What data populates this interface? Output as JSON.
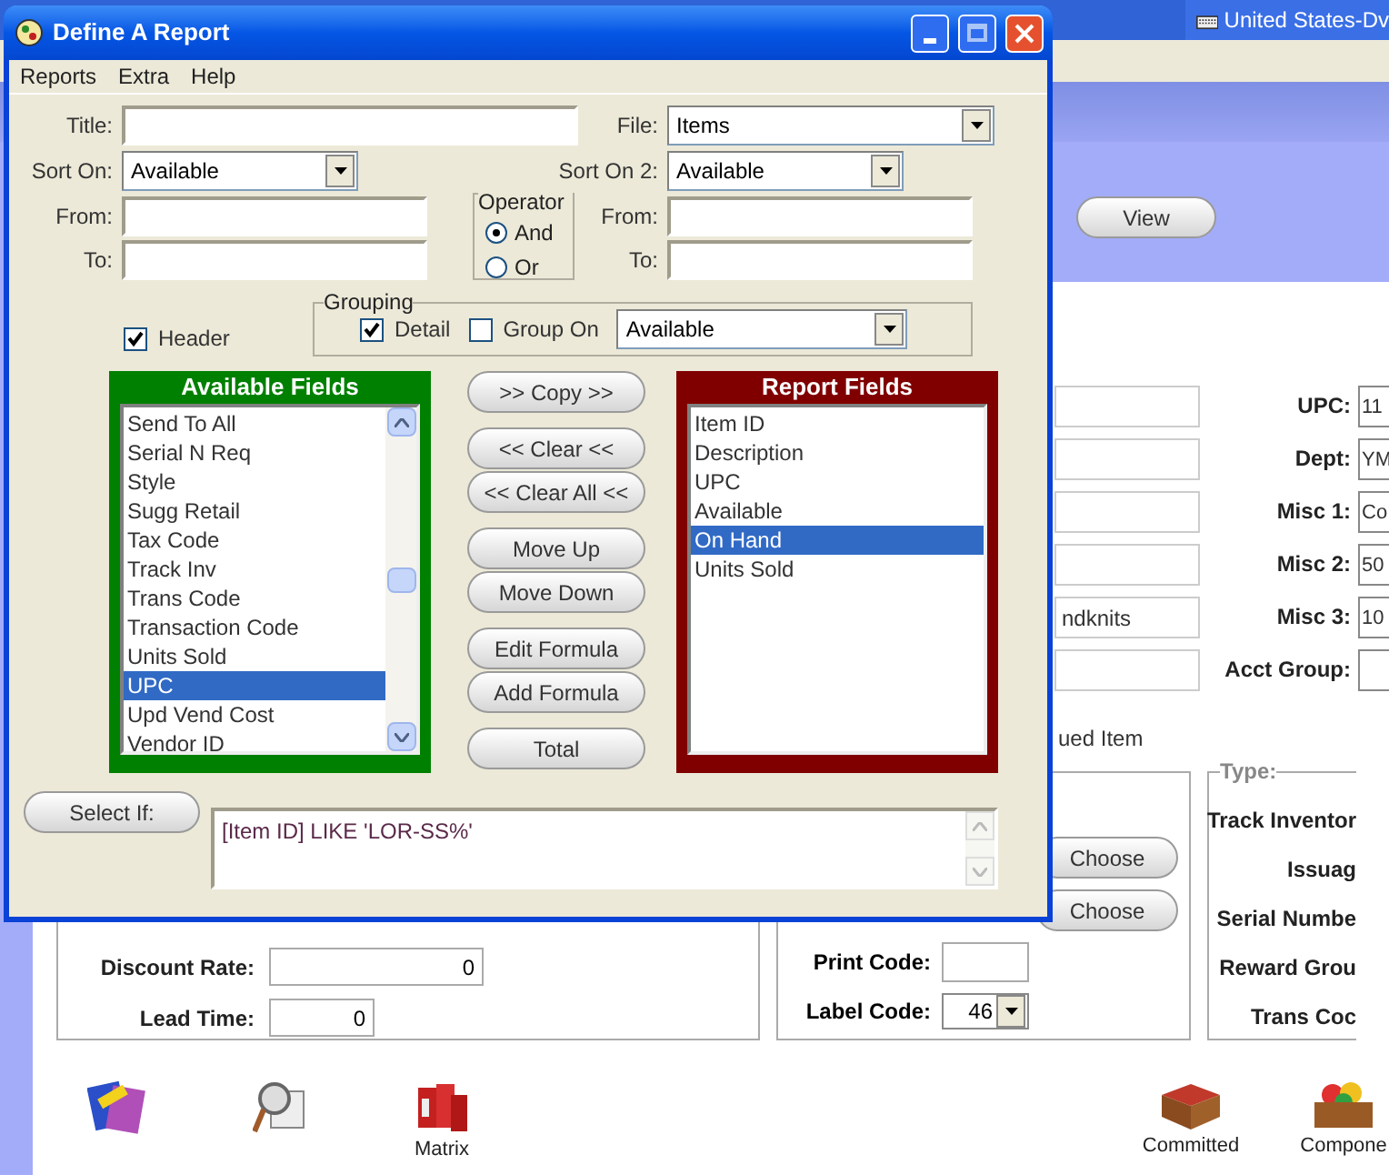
{
  "background": {
    "language_bar": "United States-Dv",
    "view_button": "View",
    "fields": [
      {
        "label": "UPC:",
        "right_value": "11"
      },
      {
        "label": "Dept:",
        "right_value": "YM"
      },
      {
        "label": "Misc 1:",
        "right_value": "Co"
      },
      {
        "label": "Misc 2:",
        "right_value": "50"
      },
      {
        "value": "ndknits",
        "label": "Misc 3:",
        "right_value": "10"
      },
      {
        "label": "Acct Group:"
      }
    ],
    "note": "ued Item",
    "cost_panel": [
      {
        "label": "Discount Rate:",
        "value": "0",
        "kind": "wide"
      },
      {
        "label": "Lead Time:",
        "value": "0",
        "kind": "narrow"
      }
    ],
    "code_panel": {
      "choose_buttons": [
        "Choose",
        "Choose"
      ],
      "print_code": "Print Code:",
      "label_code": "Label Code:",
      "label_code_value": "46"
    },
    "type_panel": {
      "legend": "Type:",
      "labels": [
        "Track Inventor",
        "Issuag",
        "Serial Numbe",
        "Reward Grou",
        "Trans Coc"
      ]
    },
    "toolbar": [
      {
        "kind": "catalog"
      },
      {
        "kind": "po"
      },
      {
        "kind": "matrix",
        "label": "Matrix"
      },
      {
        "kind": "hold",
        "label": "Committed"
      },
      {
        "kind": "parts",
        "label": "Compone"
      }
    ]
  },
  "dialog": {
    "title": "Define A Report",
    "menu": [
      "Reports",
      "Extra",
      "Help"
    ],
    "title_field": {
      "label": "Title:"
    },
    "file": {
      "label": "File:",
      "value": "Items"
    },
    "sort_on": {
      "label": "Sort On:",
      "value": "Available"
    },
    "sort_on_2": {
      "label": "Sort On 2:",
      "value": "Available"
    },
    "from": {
      "label": "From:"
    },
    "to": {
      "label": "To:"
    },
    "operator": {
      "legend": "Operator",
      "options": [
        {
          "label": "And",
          "selected": true
        },
        {
          "label": "Or",
          "selected": false
        }
      ]
    },
    "from_2": {
      "label": "From:"
    },
    "to_2": {
      "label": "To:"
    },
    "header": {
      "label": "Header",
      "checked": true
    },
    "grouping": {
      "legend": "Grouping",
      "detail": {
        "label": "Detail",
        "checked": true
      },
      "group_on": {
        "label": "Group On",
        "checked": false
      },
      "group_field": "Available"
    },
    "available_fields": {
      "title": "Available Fields",
      "items": [
        {
          "label": "Send To All",
          "selected": false
        },
        {
          "label": "Serial N Req",
          "selected": false
        },
        {
          "label": "Style",
          "selected": false
        },
        {
          "label": "Sugg Retail",
          "selected": false
        },
        {
          "label": "Tax Code",
          "selected": false
        },
        {
          "label": "Track Inv",
          "selected": false
        },
        {
          "label": "Trans Code",
          "selected": false
        },
        {
          "label": "Transaction Code",
          "selected": false
        },
        {
          "label": "Units Sold",
          "selected": false
        },
        {
          "label": "UPC",
          "selected": true
        },
        {
          "label": "Upd Vend Cost",
          "selected": false
        },
        {
          "label": "Vendor ID",
          "selected": false
        }
      ]
    },
    "buttons": [
      [
        ">> Copy >>"
      ],
      [
        "<< Clear <<",
        "<< Clear All <<"
      ],
      [
        "Move Up",
        "Move Down"
      ],
      [
        "Edit Formula",
        "Add Formula"
      ],
      [
        "Total"
      ]
    ],
    "report_fields": {
      "title": "Report Fields",
      "items": [
        {
          "label": "Item ID",
          "selected": false
        },
        {
          "label": "Description",
          "selected": false
        },
        {
          "label": "UPC",
          "selected": false
        },
        {
          "label": "Available",
          "selected": false
        },
        {
          "label": "On Hand",
          "selected": true
        },
        {
          "label": "Units Sold",
          "selected": false
        }
      ]
    },
    "select_if": {
      "button": "Select If:",
      "value": "[Item ID] LIKE 'LOR-SS%'"
    }
  }
}
